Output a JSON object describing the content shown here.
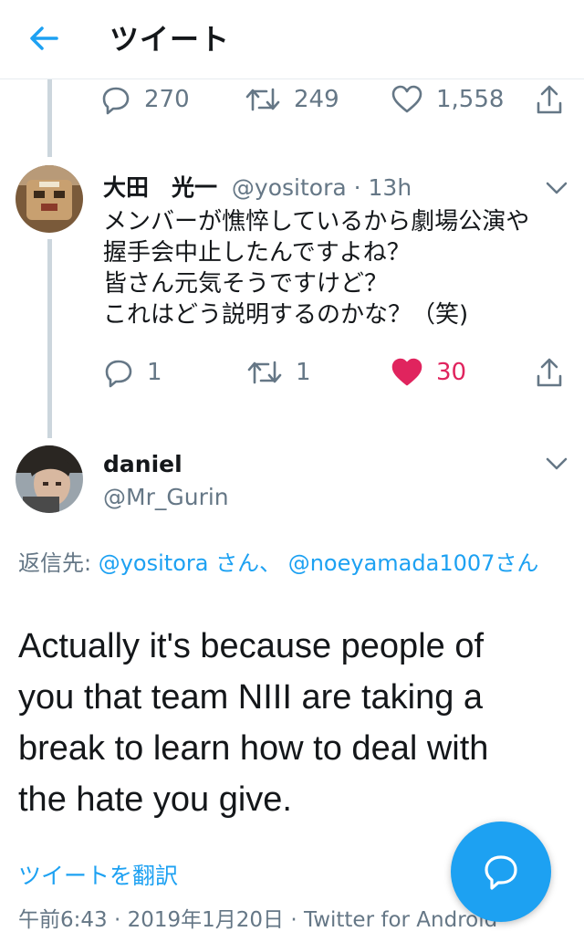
{
  "header": {
    "title": "ツイート"
  },
  "prev_tweet": {
    "replies": "270",
    "retweets": "249",
    "likes": "1,558"
  },
  "tweet1": {
    "name": "大田　光一",
    "handle": "@yositora",
    "time": "13h",
    "body_lines": [
      "メンバーが憔悴しているから劇場公演や",
      "握手会中止したんですよね？",
      "皆さん元気そうですけど？",
      "これはどう説明するのかな？（笑)"
    ],
    "replies": "1",
    "retweets": "1",
    "likes": "30",
    "like_color": "#e0245e"
  },
  "tweet2": {
    "name": "daniel",
    "handle": "@Mr_Gurin",
    "reply_prefix": "返信先: ",
    "mention1": "@yositora さん、",
    "mention2": "@noeyamada1007さん",
    "body_lines": [
      "Actually it's because people of",
      "you that team NIII are taking a",
      "break to learn how to deal with",
      "the hate you give."
    ],
    "translate": "ツイートを翻訳",
    "timestamp": "午前6:43 · 2019年1月20日 · Twitter for Android"
  },
  "colors": {
    "accent": "#1da1f2",
    "muted": "#657786",
    "like": "#e0245e"
  },
  "icons": [
    "back-arrow-icon",
    "reply-icon",
    "retweet-icon",
    "like-icon",
    "share-icon",
    "chevron-down-icon",
    "compose-message-icon"
  ]
}
